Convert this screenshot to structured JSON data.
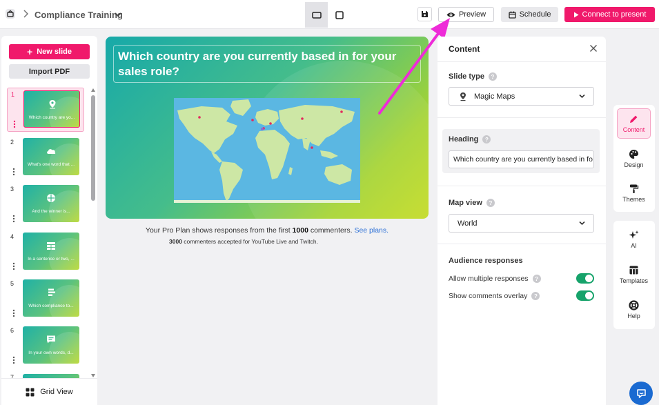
{
  "header": {
    "title": "Compliance Training",
    "preview_label": "Preview",
    "schedule_label": "Schedule",
    "connect_label": "Connect to present"
  },
  "sidebar": {
    "new_slide_label": "New slide",
    "import_pdf_label": "Import PDF",
    "grid_view_label": "Grid View",
    "slides": [
      {
        "number": "1",
        "text": "Which country are yo...",
        "icon": "map-pin-icon"
      },
      {
        "number": "2",
        "text": "What's one word that ...",
        "icon": "cloud-icon"
      },
      {
        "number": "3",
        "text": "And the winner is...",
        "icon": "wheel-icon"
      },
      {
        "number": "4",
        "text": "In a sentence or two, ...",
        "icon": "table-icon"
      },
      {
        "number": "5",
        "text": "Which compliance to...",
        "icon": "ranking-icon"
      },
      {
        "number": "6",
        "text": "In your own words, d...",
        "icon": "chat-bubble-icon"
      },
      {
        "number": "7",
        "text": "",
        "icon": ""
      }
    ]
  },
  "canvas": {
    "heading": "Which country are you currently based in for your sales role?",
    "note_prefix": "Your Pro Plan shows responses from the first ",
    "note_count": "1000",
    "note_mid": " commenters. ",
    "note_link": "See plans.",
    "note2_count": "3000",
    "note2_text": " commenters accepted for YouTube Live and Twitch."
  },
  "content_panel": {
    "title": "Content",
    "slide_type_label": "Slide type",
    "slide_type_value": "Magic Maps",
    "heading_label": "Heading",
    "heading_value": "Which country are you currently based in fo",
    "map_view_label": "Map view",
    "map_view_value": "World",
    "audience_label": "Audience responses",
    "allow_multiple_label": "Allow multiple responses",
    "allow_multiple_on": true,
    "show_comments_label": "Show comments overlay",
    "show_comments_on": true
  },
  "tools": {
    "content": "Content",
    "design": "Design",
    "themes": "Themes",
    "ai": "AI",
    "templates": "Templates",
    "help": "Help"
  },
  "colors": {
    "accent": "#f0196b",
    "toggle_on": "#17a36b",
    "link": "#2a6fd6"
  }
}
